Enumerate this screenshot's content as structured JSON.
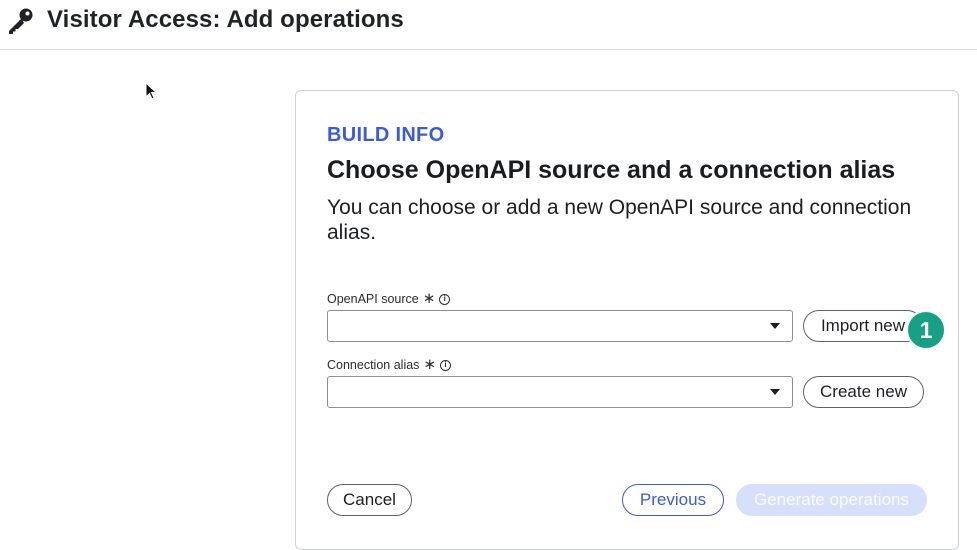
{
  "header": {
    "title": "Visitor Access: Add operations"
  },
  "card": {
    "eyebrow": "BUILD INFO",
    "title": "Choose OpenAPI source and a connection alias",
    "subtitle": "You can choose or add a new OpenAPI source and connection alias."
  },
  "fields": {
    "openapi": {
      "label": "OpenAPI source",
      "required_mark": "∗",
      "info": "i",
      "value": "",
      "action_label": "Import new"
    },
    "alias": {
      "label": "Connection alias",
      "required_mark": "∗",
      "info": "i",
      "value": "",
      "action_label": "Create new"
    }
  },
  "footer": {
    "cancel_label": "Cancel",
    "previous_label": "Previous",
    "generate_label": "Generate operations"
  },
  "step_badge": "1",
  "colors": {
    "accent": "#3b5bdb",
    "badge": "#16a085",
    "disabled": "#d7e0fb"
  }
}
